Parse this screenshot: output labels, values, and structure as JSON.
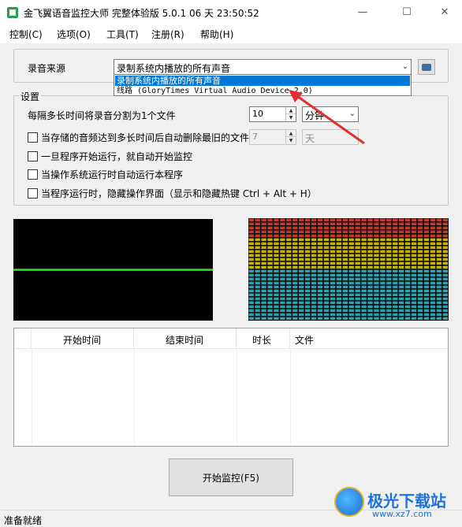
{
  "window": {
    "title": "金飞翼语音监控大师 完整体验版 5.0.1 06 天 23:50:52",
    "minimize": "—",
    "maximize": "☐",
    "close": "✕"
  },
  "menu": {
    "items": [
      "控制(C)",
      "选项(O)",
      "工具(T)",
      "注册(R)",
      "帮助(H)"
    ]
  },
  "source": {
    "label": "录音来源",
    "selected": "录制系统内播放的所有声音",
    "options": [
      "录制系统内播放的所有声音",
      "线路 (GloryTimes Virtual Audio Device 2.0)"
    ]
  },
  "settings": {
    "title": "设置",
    "split_label": "每隔多长时间将录音分割为1个文件",
    "split_value": "10",
    "split_unit": "分钟",
    "auto_delete_label": "当存储的音频达到多长时间后自动删除最旧的文件",
    "auto_delete_value": "7",
    "auto_delete_unit": "天",
    "auto_start_label": "一旦程序开始运行，就自动开始监控",
    "run_on_boot_label": "当操作系统运行时自动运行本程序",
    "hide_ui_label": "当程序运行时，隐藏操作界面（显示和隐藏热键 Ctrl + Alt + H）"
  },
  "table": {
    "columns": [
      "开始时间",
      "结束时间",
      "时长",
      "文件"
    ],
    "rows": []
  },
  "start_button": "开始监控(F5)",
  "status": "准备就绪",
  "watermark": {
    "title": "极光下载站",
    "url": "www.xz7.com"
  },
  "colors": {
    "wave_line": "#22cc22",
    "meter_top": "#c0392b",
    "meter_mid": "#c8b400",
    "meter_bottom": "#2aa3b0",
    "selection": "#0078d7",
    "annotation_arrow": "#e03030"
  },
  "icons": {
    "app": "app-icon",
    "config_button": "device-settings-icon",
    "dropdown": "chevron-down-icon"
  }
}
